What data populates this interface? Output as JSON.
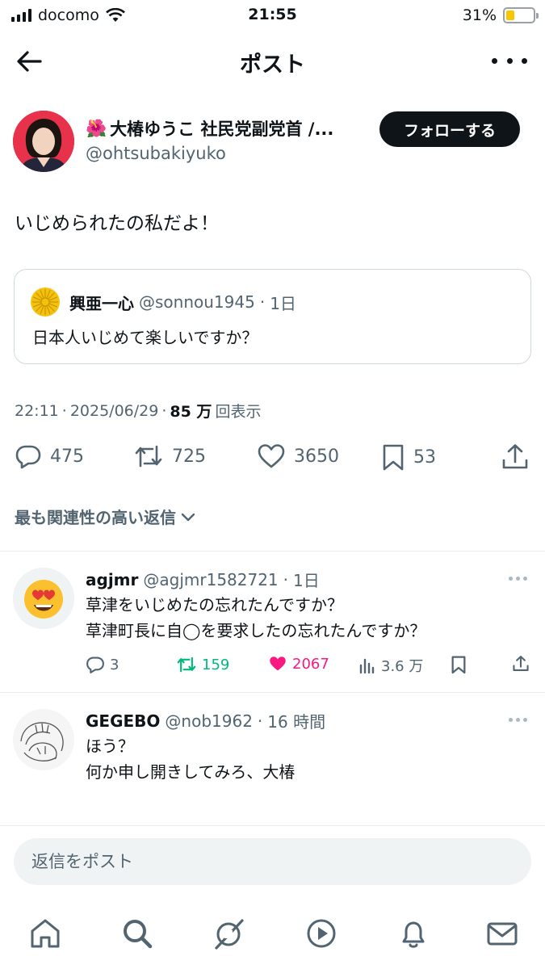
{
  "status_bar": {
    "carrier": "docomo",
    "time": "21:55",
    "battery": "31%",
    "battery_level": 0.31
  },
  "header": {
    "title": "ポスト",
    "back_icon": "arrow-left-icon",
    "more_icon": "more-horizontal-icon"
  },
  "post": {
    "author_emoji": "🌺",
    "author_name": "大椿ゆうこ 社民党副党首 /...",
    "author_handle": "@ohtsubakiyuko",
    "follow_label": "フォローする",
    "text": "いじめられたの私だよ！",
    "quote": {
      "name": "興亜一心",
      "handle": "@sonnou1945",
      "sep": "·",
      "time": "1日",
      "text": "日本人いじめて楽しいですか？"
    },
    "meta": {
      "time": "22:11",
      "sep1": "·",
      "date": "2025/06/29",
      "sep2": "·",
      "views": "85 万",
      "views_suffix": "回表示"
    },
    "actions": {
      "replies": "475",
      "reposts": "725",
      "likes": "3650",
      "bookmarks": "53"
    }
  },
  "sort_label": "最も関連性の高い返信",
  "replies": [
    {
      "name": "agjmr",
      "handle": "@agjmr1582721",
      "sep": "·",
      "time": "1日",
      "lines": [
        "草津をいじめたの忘れたんですか？",
        "草津町長に自◯を要求したの忘れたんですか？"
      ],
      "stats": {
        "replies": "3",
        "reposts": "159",
        "likes": "2067",
        "views": "3.6 万"
      }
    },
    {
      "name": "GEGEBO",
      "handle": "@nob1962",
      "sep": "·",
      "time": "16 時間",
      "lines": [
        "ほう？",
        "何か申し開きしてみろ、大椿"
      ]
    }
  ],
  "reply_box": {
    "placeholder": "返信をポスト"
  },
  "tabbar": [
    "home-icon",
    "search-icon",
    "grok-icon",
    "play-icon",
    "bell-icon",
    "mail-icon"
  ],
  "colors": {
    "text": "#0f1419",
    "muted": "#536471",
    "repost_green": "#00ba7c",
    "like_pink": "#f91880",
    "battery_yellow": "#f7c600"
  }
}
